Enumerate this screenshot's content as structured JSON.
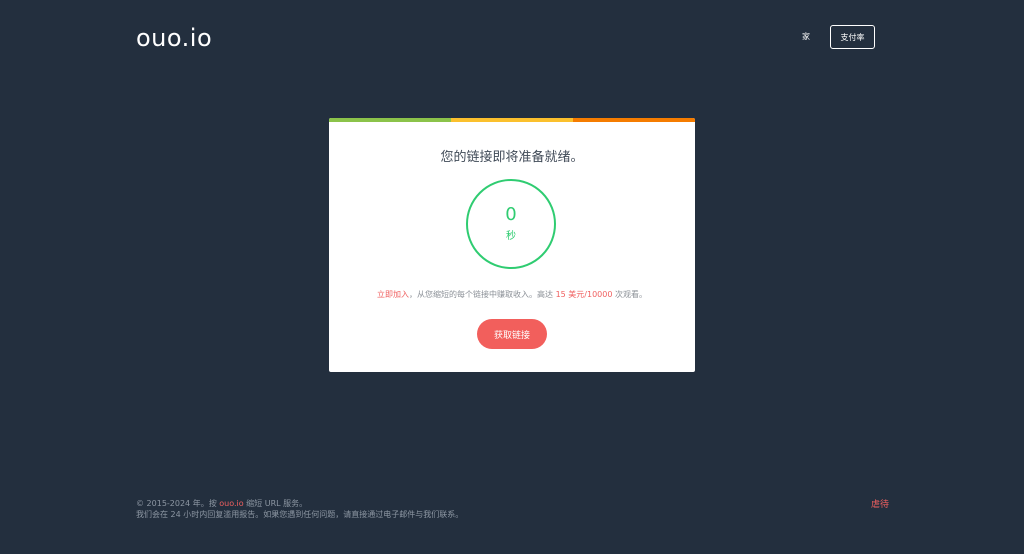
{
  "header": {
    "logo": "ouo.io",
    "nav_home": "家",
    "nav_rates": "支付率"
  },
  "card": {
    "stripe_colors": [
      "#8bc34a",
      "#fbc02d",
      "#f57c00"
    ],
    "title": "您的链接即将准备就绪。",
    "countdown_value": "0",
    "countdown_unit": "秒",
    "promo": {
      "join_link": "立即加入",
      "text_middle": "，从您缩短的每个链接中赚取收入。高达 ",
      "rate": "15 美元/10000",
      "text_end": " 次观看。"
    },
    "button_label": "获取链接"
  },
  "footer": {
    "line1_prefix": "© 2015-2024 年。按 ",
    "line1_brand": "ouo.io",
    "line1_suffix": " 缩短 URL 服务。",
    "line2": "我们会在 24 小时内回复滥用报告。如果您遇到任何问题，请直接通过电子邮件与我们联系。",
    "abuse_link": "虐待"
  }
}
